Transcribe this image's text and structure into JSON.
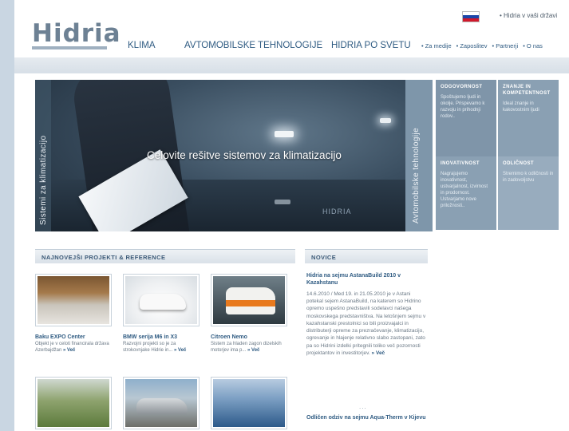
{
  "header": {
    "logo_text": "Hidria",
    "language_flag": "slovenia-flag",
    "country_link": "• Hidria v vaši državi",
    "main_nav": [
      "KLIMA",
      "AVTOMOBILSKE TEHNOLOGIJE",
      "HIDRIA PO SVETU"
    ],
    "sub_nav": [
      "• Za medije",
      "• Zaposlitev",
      "• Partnerji",
      "• O nas"
    ]
  },
  "hero": {
    "caption": "Celovite rešitve sistemov za klimatizacijo",
    "left_label": "Sistemi za klimatizacijo",
    "right_label": "Avtomobilske tehnologije",
    "board_text": "HIDRIA"
  },
  "panel": {
    "cells": [
      {
        "title": "ODGOVORNOST",
        "desc": "Spoštujemo ljudi in okolje. Prispevamo k razvoju in prihodnji rodov.."
      },
      {
        "title": "ZNANJE IN KOMPETENTNOST",
        "desc": "Ideal znanje in kakovostnim ljudi"
      },
      {
        "title": "INOVATIVNOST",
        "desc": "Nagrajujemo inovativnost, ustvarjalnost, izvirnost in prodornost. Ustvarjamo nove priložnosti.."
      },
      {
        "title": "ODLIČNOST",
        "desc": "Stremimo k odličnosti in in zadovoljstvu"
      }
    ]
  },
  "projects": {
    "header": "NAJNOVEJŠI PROJEKTI & REFERENCE",
    "items": [
      {
        "title": "Baku EXPO Center",
        "desc": "Objekt je v celoti financirala država Azerbajdžan",
        "more": "» Več"
      },
      {
        "title": "BMW serija M6 in X3",
        "desc": "Razvojni projekti so je za strokovnjake Hidrie in...",
        "more": "» Več"
      },
      {
        "title": "Citroen Nemo",
        "desc": "Sistem za hladen zagon dizelskih motorjev ima p...",
        "more": "» Več"
      }
    ]
  },
  "news": {
    "header": "NOVICE",
    "items": [
      {
        "title": "Hidria na sejmu AstanaBuild 2010 v Kazahstanu",
        "body": "14.6.2010 / Med 19. in 21.05.2010 je v Astani potekal sejem AstanaBuild, na katerem so Hidrino opremo uspešno predstavili sodelavci našega moskovskega predstavništva. Na letošnjem sejmu v kazahstanski prestolnici so bili proizvajalci in distributerji opreme za prezračevanje, klimatizacijo, ogrevanje in hlajenje relativno slabo zastopani, zato pa so Hidrini izdelki pritegnili toliko več pozornosti projektantov in investitorjev.",
        "more": "» Več"
      },
      {
        "title": "Odličen odziv na sejmu Aqua-Therm v Kijevu"
      }
    ],
    "dots": "..."
  }
}
